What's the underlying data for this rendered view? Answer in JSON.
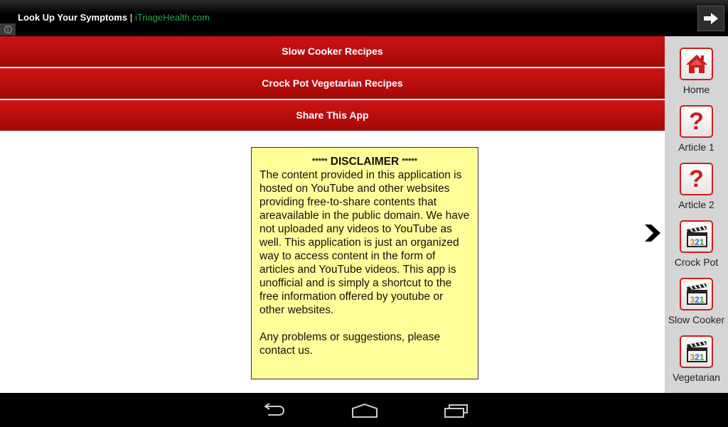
{
  "ad": {
    "title": "Look Up Your Symptoms",
    "separator": " | ",
    "link": "iTriageHealth.com",
    "info_icon": "info-icon",
    "next_icon": "arrow-right-icon"
  },
  "menu": [
    {
      "label": "Slow Cooker Recipes"
    },
    {
      "label": "Crock Pot Vegetarian Recipes"
    },
    {
      "label": "Share This App"
    }
  ],
  "disclaimer": {
    "stars": "*****",
    "title": "DISCLAIMER",
    "body": "The content provided in this application is hosted on YouTube and other websites providing free-to-share contents that areavailable in the public domain. We have not uploaded any videos to YouTube as well. This application is just an organized way to access content in the form of articles and YouTube videos. This app is unofficial and is simply a shortcut to the free information offered by youtube or other websites.",
    "footer": "Any problems or suggestions, please contact us."
  },
  "expand_icon": "chevron-right-icon",
  "sidebar": {
    "items": [
      {
        "label": "Home",
        "icon": "home-icon"
      },
      {
        "label": "Article 1",
        "icon": "question-icon"
      },
      {
        "label": "Article 2",
        "icon": "question-icon"
      },
      {
        "label": "Crock Pot",
        "icon": "video-clapper-icon"
      },
      {
        "label": "Slow Cooker",
        "icon": "video-clapper-icon"
      },
      {
        "label": "Vegetarian",
        "icon": "video-clapper-icon"
      }
    ],
    "clapper_digits": "321"
  },
  "nav": {
    "back_icon": "back-icon",
    "home_icon": "home-outline-icon",
    "recents_icon": "recent-apps-icon"
  },
  "colors": {
    "accent_red": "#cd1214",
    "disclaimer_bg": "#ffff99",
    "ad_link": "#2aa84a",
    "sidebar_bg": "#d5d5d5"
  }
}
